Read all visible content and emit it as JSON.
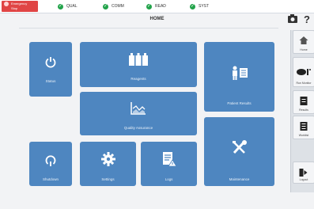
{
  "brand": {
    "line1": "Emergency",
    "line2": "Stop"
  },
  "status": [
    {
      "label": "QUAL"
    },
    {
      "label": "COMM"
    },
    {
      "label": "READ"
    },
    {
      "label": "SYST"
    }
  ],
  "header": {
    "title": "HOME"
  },
  "tiles": {
    "status": "Status",
    "reagents": "Reagents",
    "patient_results": "Patient Results",
    "quality_assurance": "Quality Assurance",
    "maintenance": "Maintenance",
    "shutdown": "Shutdown",
    "settings": "Settings",
    "logs": "Logs"
  },
  "sidebar": {
    "home": "Home",
    "run_monitor": "Run Monitor",
    "results": "Results",
    "worklist": "Worklist",
    "logout": "Logout"
  },
  "colors": {
    "tile": "#4e86c0",
    "brand": "#e04545",
    "status_ok": "#22a34a"
  }
}
